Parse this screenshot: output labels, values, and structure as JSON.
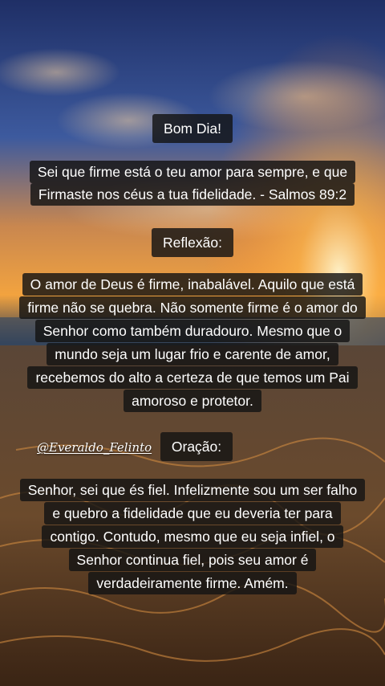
{
  "greeting": "Bom Dia!",
  "verse": {
    "line1": "Sei que firme está o teu amor para sempre, e que",
    "line2": "Firmaste nos céus a tua fidelidade. - Salmos 89:2"
  },
  "reflection_title": "Reflexão:",
  "reflection": {
    "line1": "O amor de Deus é firme, inabalável. Aquilo que está",
    "line2": "firme não se quebra. Não somente firme é o amor do",
    "line3": "Senhor como também duradouro. Mesmo que o",
    "line4": "mundo seja um lugar frio e carente de amor,",
    "line5": "recebemos do alto a certeza de que temos um Pai",
    "line6": "amoroso e protetor."
  },
  "watermark": "@Everaldo_Felinto",
  "prayer_title": "Oração:",
  "prayer": {
    "line1": "Senhor, sei que és fiel. Infelizmente sou um ser falho",
    "line2": "e quebro a fidelidade que eu deveria ter para",
    "line3": "contigo. Contudo, mesmo que eu seja infiel, o",
    "line4": "Senhor continua fiel, pois seu amor é",
    "line5": "verdadeiramente firme. Amém."
  }
}
